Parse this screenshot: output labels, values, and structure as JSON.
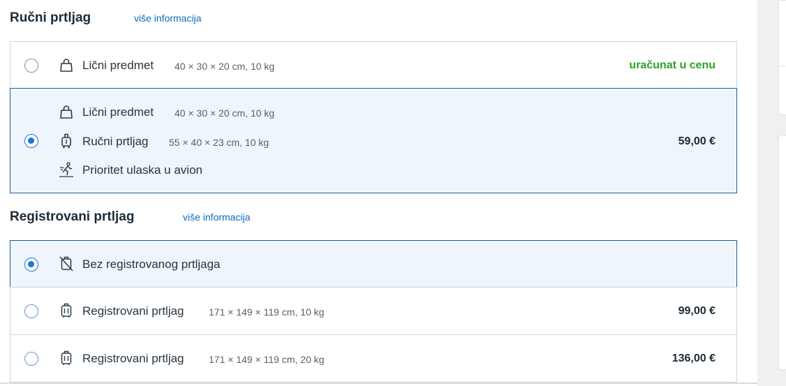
{
  "hand_luggage": {
    "title": "Ručni prtljag",
    "more_info": "više informacija",
    "option_1": {
      "item_label": "Lični predmet",
      "item_dims": "40 × 30 × 20 cm, 10 kg",
      "price": "uračunat u cenu",
      "selected": false
    },
    "option_2": {
      "selected": true,
      "items": [
        {
          "label": "Lični predmet",
          "dims": "40 × 30 × 20 cm, 10 kg",
          "icon": "bag-icon"
        },
        {
          "label": "Ručni prtljag",
          "dims": "55 × 40 × 23 cm, 10 kg",
          "icon": "trolley-icon"
        },
        {
          "label": "Prioritet ulaska u avion",
          "dims": "",
          "icon": "priority-boarding-icon"
        }
      ],
      "price": "59,00 €"
    }
  },
  "checked_luggage": {
    "title": "Registrovani prtljag",
    "more_info": "više informacija",
    "options": [
      {
        "label": "Bez registrovanog prtljaga",
        "dims": "",
        "price": "",
        "selected": true,
        "icon": "no-luggage-icon"
      },
      {
        "label": "Registrovani prtljag",
        "dims": "171 × 149 × 119 cm, 10 kg",
        "price": "99,00 €",
        "selected": false,
        "icon": "suitcase-icon"
      },
      {
        "label": "Registrovani prtljag",
        "dims": "171 × 149 × 119 cm, 20 kg",
        "price": "136,00 €",
        "selected": false,
        "icon": "suitcase-icon"
      }
    ]
  },
  "colors": {
    "accent": "#1b74d8",
    "link": "#0a6cbd",
    "included": "#2aa02a",
    "selected_bg": "#eef5fb",
    "selected_border": "#1a5fa0"
  }
}
